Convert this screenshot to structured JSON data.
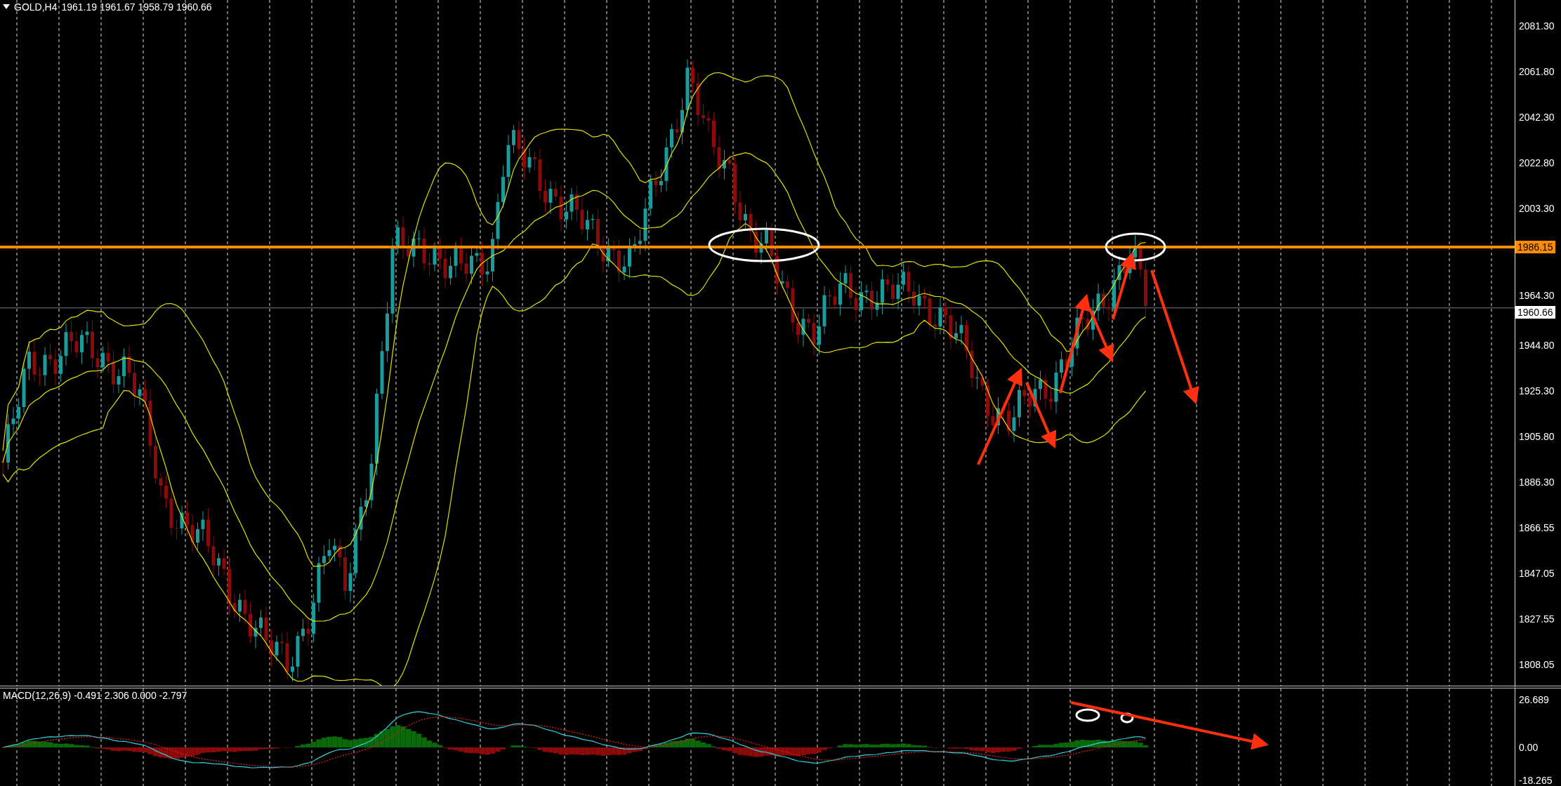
{
  "chart_header": {
    "symbol": "GOLD,H4",
    "open": "1961.19",
    "high": "1961.67",
    "low": "1958.79",
    "close": "1960.66"
  },
  "price_axis": {
    "labels": [
      "2081.30",
      "2061.80",
      "2042.30",
      "2022.80",
      "2003.30",
      "1964.30",
      "1944.80",
      "1925.30",
      "1905.80",
      "1886.30",
      "1866.55",
      "1847.05",
      "1827.55",
      "1808.05"
    ],
    "level_tag": "1986.15",
    "current_tag": "1960.66"
  },
  "macd": {
    "header": "MACD(12,26,9) -0.491 2.306 0.000 -2.797",
    "axis_labels": [
      "26.689",
      "0.00",
      "-18.265"
    ]
  }
}
